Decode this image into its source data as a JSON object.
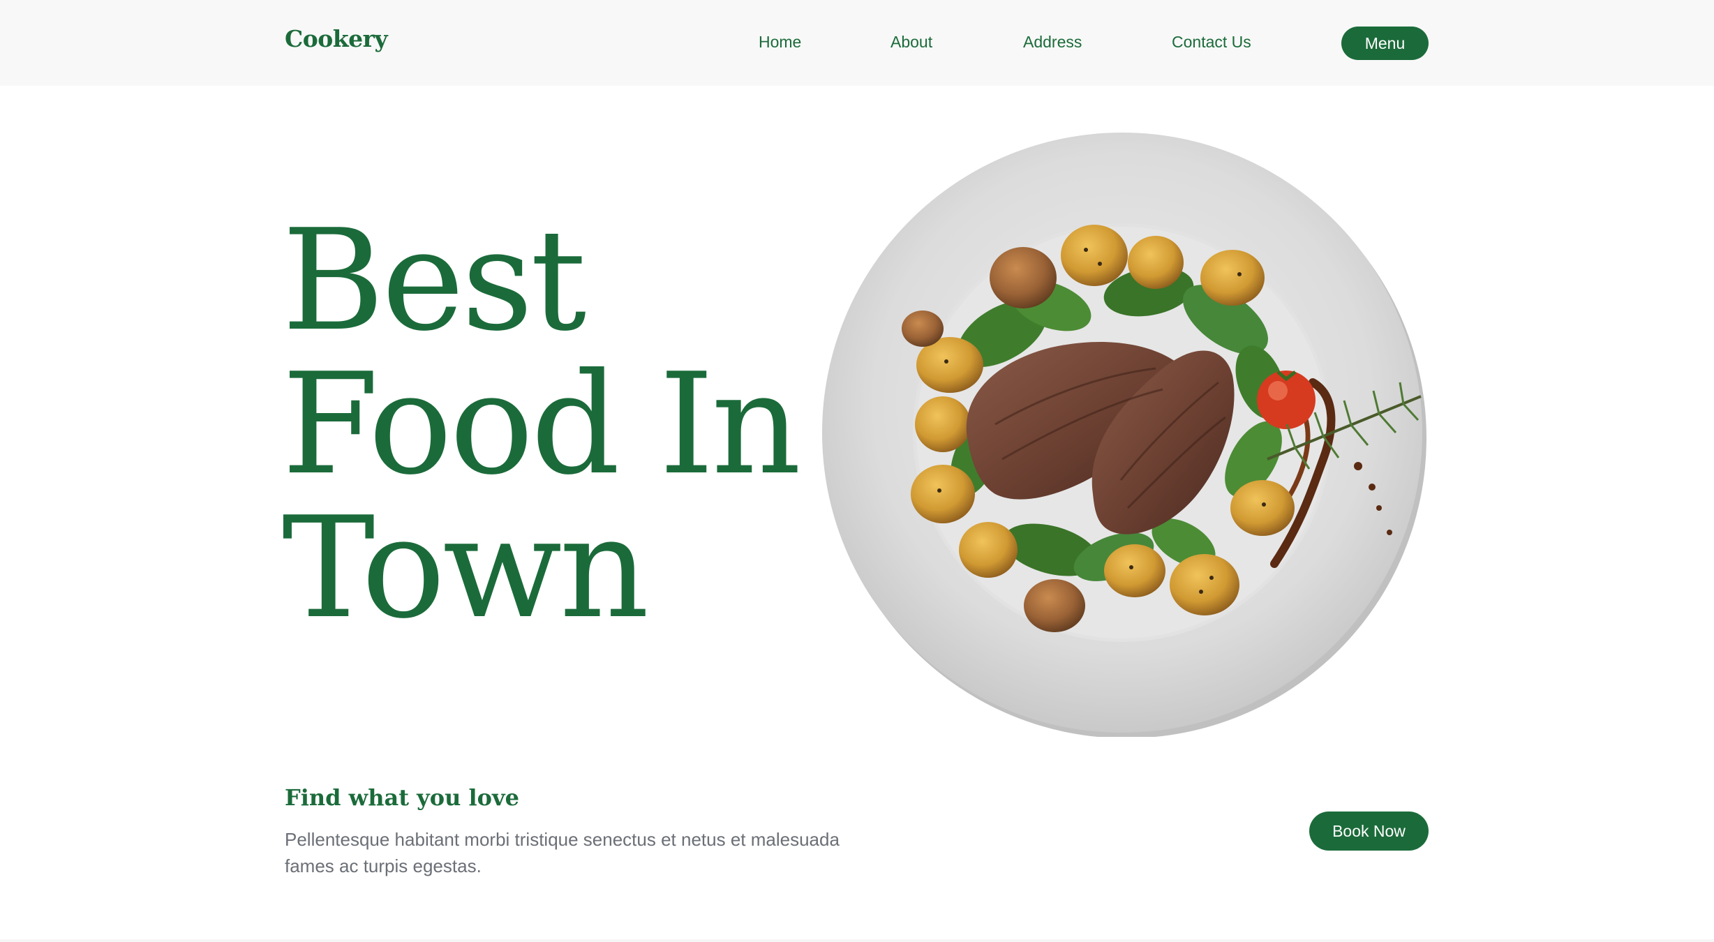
{
  "header": {
    "brand": "Cookery",
    "nav": [
      "Home",
      "About",
      "Address",
      "Contact Us"
    ],
    "menu_button": "Menu"
  },
  "hero": {
    "title_lines": [
      "Best",
      "Food In",
      "Town"
    ],
    "image_icon": "steak-plate-illustration"
  },
  "footer_section": {
    "tagline": "Find what you love",
    "description": "Pellentesque habitant morbi tristique senectus et netus et malesuada fames ac turpis egestas.",
    "book_button": "Book Now"
  },
  "colors": {
    "brand_green": "#1b6b3a",
    "text_gray": "#6b6f76",
    "nav_bg": "#f8f8f8"
  }
}
